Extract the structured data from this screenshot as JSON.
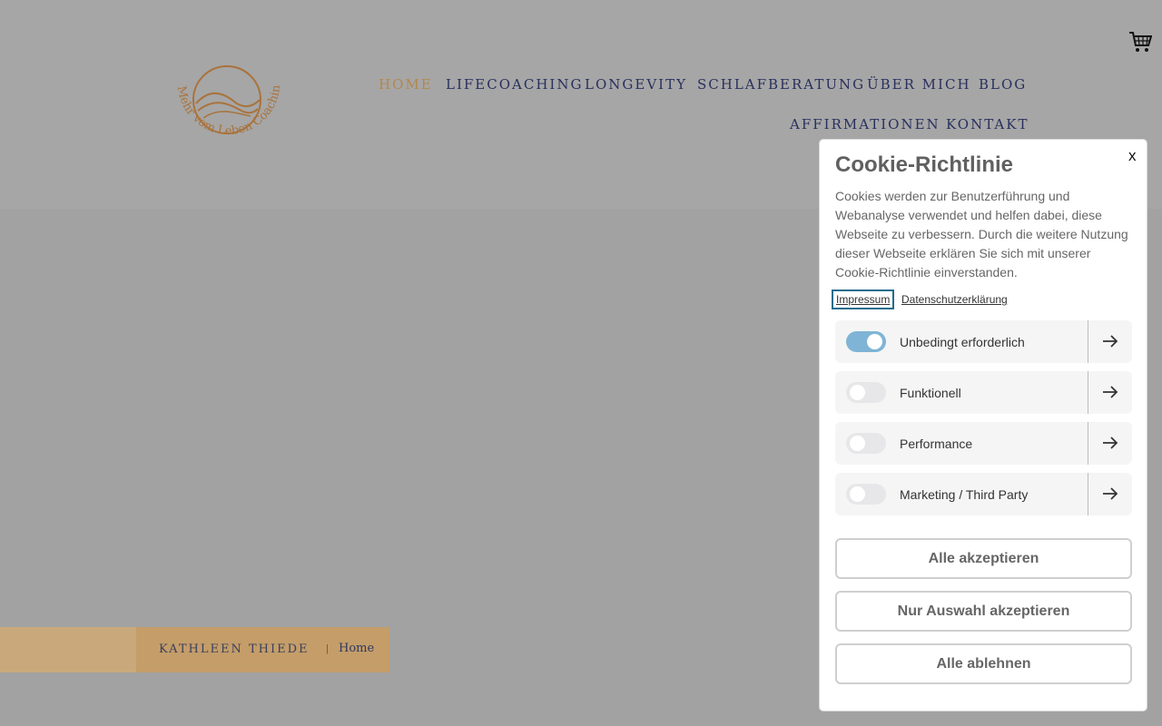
{
  "header": {
    "logo_text": "Mehr vom Leben Coaching",
    "cart_icon": "cart-icon",
    "nav": [
      {
        "label": "HOME",
        "active": true
      },
      {
        "label": "LIFECOACHING",
        "active": false
      },
      {
        "label": "LONGEVITY",
        "active": false
      },
      {
        "label": "SCHLAFBERATUNG",
        "active": false
      },
      {
        "label": "ÜBER MICH",
        "active": false
      },
      {
        "label": "BLOG",
        "active": false
      },
      {
        "label": "AFFIRMATIONEN",
        "active": false
      },
      {
        "label": "KONTAKT",
        "active": false
      }
    ]
  },
  "breadcrumb": {
    "brand": "KATHLEEN THIEDE",
    "separator": "|",
    "current": "Home"
  },
  "cookie_modal": {
    "close_label": "x",
    "title": "Cookie-Richtlinie",
    "text": "Cookies werden zur Benutzerführung und Webanalyse verwendet und helfen dabei, diese Webseite zu verbessern. Durch die weitere Nutzung dieser Webseite erklären Sie sich mit unserer Cookie-Richtlinie einverstanden.",
    "links": {
      "impressum": "Impressum",
      "datenschutz": "Datenschutzerklärung"
    },
    "categories": [
      {
        "label": "Unbedingt erforderlich",
        "enabled": true
      },
      {
        "label": "Funktionell",
        "enabled": false
      },
      {
        "label": "Performance",
        "enabled": false
      },
      {
        "label": "Marketing / Third Party",
        "enabled": false
      }
    ],
    "buttons": {
      "accept_all": "Alle akzeptieren",
      "accept_selection": "Nur Auswahl akzeptieren",
      "reject_all": "Alle ablehnen"
    }
  },
  "colors": {
    "nav_text": "#28305e",
    "nav_active": "#b3884c",
    "toggle_on": "#7fb4d6",
    "overlay_grey": "#a2a2a2"
  }
}
